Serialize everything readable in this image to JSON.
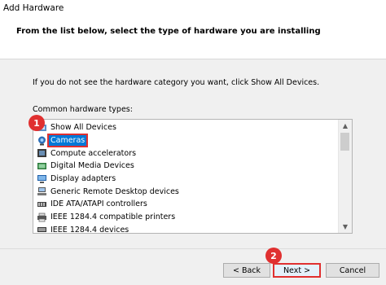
{
  "window": {
    "title": "Add Hardware"
  },
  "header": {
    "subtitle": "From the list below, select the type of hardware you are installing"
  },
  "main": {
    "instruction": "If you do not see the hardware category you want, click Show All Devices.",
    "types_label": "Common hardware types:",
    "list": {
      "items": [
        {
          "label": "Show All Devices",
          "icon": "device-icon",
          "selected": false
        },
        {
          "label": "Cameras",
          "icon": "camera-icon",
          "selected": true
        },
        {
          "label": "Compute accelerators",
          "icon": "chip-icon",
          "selected": false
        },
        {
          "label": "Digital Media Devices",
          "icon": "media-icon",
          "selected": false
        },
        {
          "label": "Display adapters",
          "icon": "monitor-icon",
          "selected": false
        },
        {
          "label": "Generic Remote Desktop devices",
          "icon": "remote-desktop-icon",
          "selected": false
        },
        {
          "label": "IDE ATA/ATAPI controllers",
          "icon": "controller-icon",
          "selected": false
        },
        {
          "label": "IEEE 1284.4 compatible printers",
          "icon": "printer-icon",
          "selected": false
        },
        {
          "label": "IEEE 1284.4 devices",
          "icon": "port-icon",
          "selected": false
        }
      ]
    }
  },
  "annotations": {
    "step1": "1",
    "step2": "2"
  },
  "buttons": {
    "back": "< Back",
    "next": "Next >",
    "cancel": "Cancel"
  },
  "colors": {
    "selection": "#0078d7",
    "highlight": "#e03030"
  }
}
